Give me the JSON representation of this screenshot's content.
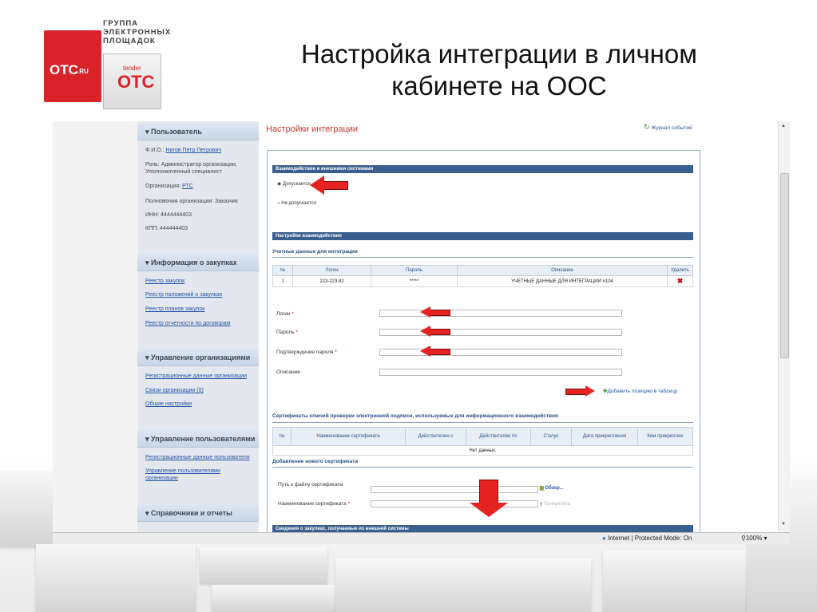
{
  "logo": {
    "group_line1": "ГРУППА",
    "group_line2": "ЭЛЕКТРОННЫХ",
    "group_line3": "ПЛОЩАДОК",
    "otc_brand": "ОТС",
    "otc_suffix": ".RU",
    "tender_small": "tender",
    "tender_big": "ОТС"
  },
  "slide": {
    "title_line1": "Настройка интеграции в личном",
    "title_line2": "кабинете на ООС"
  },
  "sidebar": {
    "user": {
      "header": "Пользователь",
      "fio_label": "Ф.И.О.:",
      "fio_value": "Нигов Петр Петрович",
      "role": "Роль: Администратор организации,",
      "role2": "Уполномоченный специалист",
      "org_label": "Организация:",
      "org_value": "РТС",
      "powers": "Полномочия организации: Заказчик",
      "inn": "ИНН: 4444444403",
      "kpp": "КПП: 444444403"
    },
    "purchases": {
      "header": "Информация о закупках",
      "links": [
        "Реестр закупок",
        "Реестр положений о закупках",
        "Реестр планов закупок",
        "Реестр отчетности по договорам"
      ]
    },
    "org_mgmt": {
      "header": "Управление организациями",
      "links": [
        "Регистрационные данные организации",
        "Связи организации (0)",
        "Общие настройки"
      ]
    },
    "users_mgmt": {
      "header": "Управление пользователями",
      "links": [
        "Регистрационные данные пользователя",
        "Управление пользователями",
        "организации"
      ]
    },
    "refs": {
      "header": "Справочники и отчеты"
    }
  },
  "main": {
    "page_title": "Настройки интеграции",
    "events_link": "Журнал событий",
    "bar_interaction": "Взаимодействие в внешними системами",
    "radio_allowed": "Допускается",
    "radio_denied": "Не допускается",
    "bar_settings": "Настройки взаимодействия",
    "credentials_header": "Учетные данные для интеграции",
    "table": {
      "columns": [
        "№",
        "Логин",
        "Пароль",
        "Описание",
        "Удалить"
      ],
      "rows": [
        {
          "num": "1",
          "login": "223-223.82",
          "password": "*****",
          "desc": "УЧЕТНЫЕ ДАННЫЕ ДЛЯ ИНТЕГРАЦИИ #104"
        }
      ]
    },
    "form": {
      "login_label": "Логин",
      "password_label": "Пароль",
      "confirm_label": "Подтверждение пароля",
      "desc_label": "Описание",
      "add_row": "Добавить позицию в таблицу"
    },
    "certs_header": "Сертификаты ключей проверки электронной подписи, используемые для информационного взаимодействия",
    "certs_table": {
      "columns": [
        "№",
        "Наименование сертификата",
        "Действителен с",
        "Действителен по",
        "Статус",
        "Дата прикрепления",
        "Кем прикреплен"
      ],
      "empty": "Нет данных."
    },
    "new_cert_header": "Добавление нового сертификата",
    "path_label": "Путь к файлу сертификата",
    "browse": "Обзор...",
    "cert_name_label": "Наименование сертификата",
    "attach": "Прикрепить",
    "bar_external": "Сведения о закупках, получаемые из внешней системы"
  },
  "statusbar": {
    "zone": "Internet | Protected Mode: On",
    "zoom": "100%"
  }
}
